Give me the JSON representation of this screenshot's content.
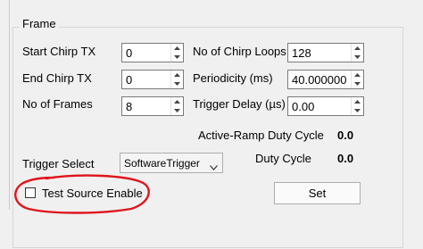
{
  "frame": {
    "title": "Frame",
    "start_chirp_tx": {
      "label": "Start Chirp TX",
      "value": "0"
    },
    "end_chirp_tx": {
      "label": "End Chirp TX",
      "value": "0"
    },
    "no_of_frames": {
      "label": "No of Frames",
      "value": "8"
    },
    "no_of_chirp_loops": {
      "label": "No of Chirp Loops",
      "value": "128"
    },
    "periodicity": {
      "label": "Periodicity (ms)",
      "value": "40.000000"
    },
    "trigger_delay": {
      "label": "Trigger Delay (µs)",
      "value": "0.00"
    },
    "active_ramp_duty_cycle": {
      "label": "Active-Ramp Duty Cycle",
      "value": "0.0"
    },
    "duty_cycle": {
      "label": "Duty Cycle",
      "value": "0.0"
    },
    "trigger_select": {
      "label": "Trigger Select",
      "value": "SoftwareTrigger"
    },
    "test_source_enable": {
      "label": "Test Source Enable",
      "checked": false
    },
    "set_button": "Set"
  },
  "annotation_color": "#e0141c"
}
